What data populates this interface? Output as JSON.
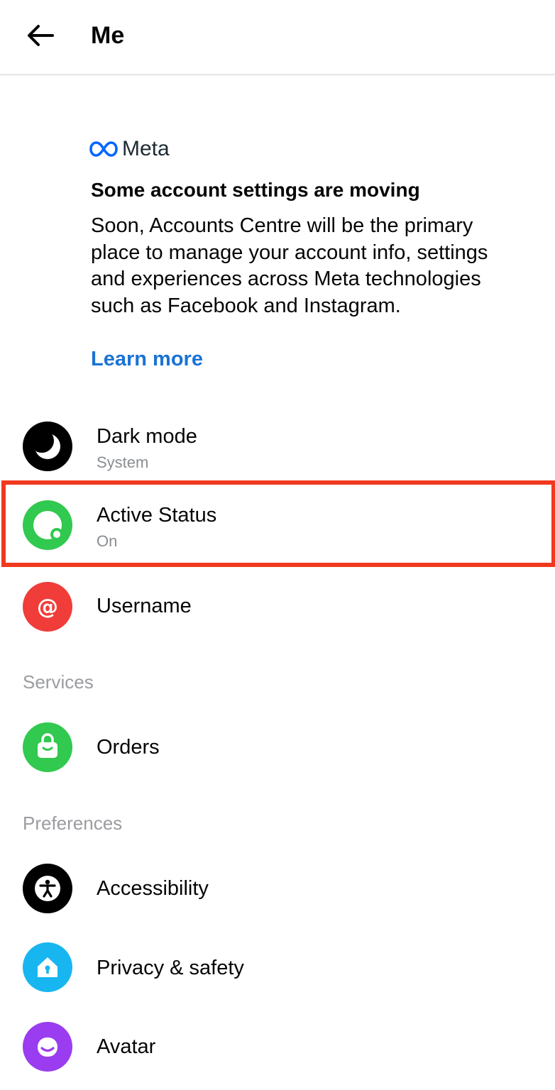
{
  "header": {
    "title": "Me",
    "back_icon": "back-arrow-icon"
  },
  "notice": {
    "brand": "Meta",
    "heading": "Some account settings are moving",
    "body_lines": [
      "Soon, Accounts Centre will be the primary",
      "place to manage your account info, settings",
      "and experiences across Meta technologies",
      "such as Facebook and Instagram."
    ],
    "link": "Learn more",
    "link_color": "#1a73d4"
  },
  "items": [
    {
      "label": "Dark mode",
      "sub": "System",
      "icon": "moon-icon",
      "color": "#000000"
    },
    {
      "label": "Active Status",
      "sub": "On",
      "icon": "active-status-icon",
      "color": "#31c94f",
      "highlighted": true
    },
    {
      "label": "Username",
      "icon": "at-sign-icon",
      "color": "#f03d3a"
    }
  ],
  "sections": [
    {
      "title": "Services",
      "items": [
        {
          "label": "Orders",
          "icon": "shopping-bag-icon",
          "color": "#31c94f"
        }
      ]
    },
    {
      "title": "Preferences",
      "items": [
        {
          "label": "Accessibility",
          "icon": "accessibility-icon",
          "color": "#000000"
        },
        {
          "label": "Privacy & safety",
          "icon": "privacy-house-icon",
          "color": "#18b6f0"
        },
        {
          "label": "Avatar",
          "icon": "avatar-icon",
          "color": "#9a3df0"
        }
      ]
    }
  ],
  "highlight_color": "#f0391f"
}
